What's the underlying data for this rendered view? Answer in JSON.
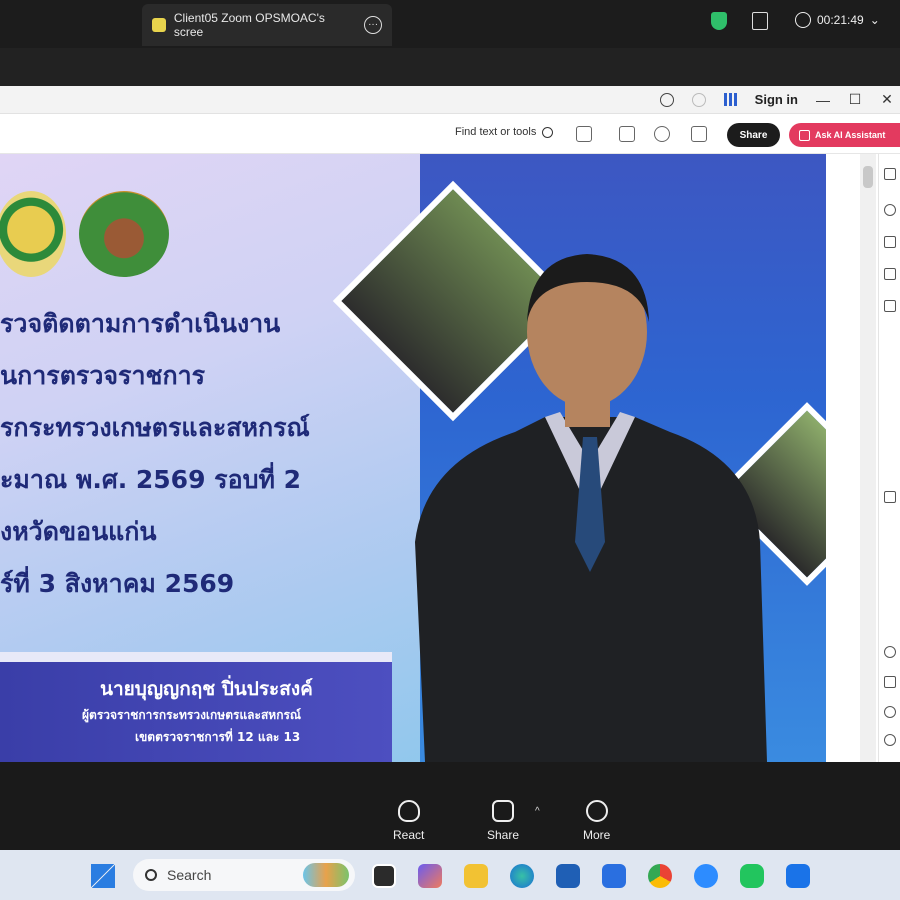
{
  "zoom": {
    "tab_title": "Client05 Zoom OPSMOAC's scree",
    "time": "00:21:49"
  },
  "browser": {
    "sign_in": "Sign in",
    "find_text": "Find text or tools",
    "share": "Share",
    "ask_ai": "Ask AI Assistant"
  },
  "slide": {
    "lines": [
      "รวจติดตามการดำเนินงาน",
      "นการตรวจราชการ",
      "รกระทรวงเกษตรและสหกรณ์",
      "ะมาณ พ.ศ. 2569 รอบที่ 2",
      "งหวัดขอนแก่น",
      "ร์ที่ 3 สิงหาคม 2569"
    ],
    "name": "นายบุญญกฤช  ปิ่นประสงค์",
    "position": "ผู้ตรวจราชการกระทรวงเกษตรและสหกรณ์",
    "region": "เขตตรวจราชการที่ 12 และ 13"
  },
  "controls": {
    "react": "React",
    "share": "Share",
    "more": "More"
  },
  "taskbar": {
    "search_placeholder": "Search"
  },
  "colors": {
    "share_button": "#1c1c1c",
    "ai_button": "#e33a5f",
    "slide_text": "#1f2a78",
    "name_banner": "#3a3ea8"
  },
  "icons": [
    "shield-icon",
    "notes-icon",
    "clock-icon",
    "help-icon",
    "bell-icon",
    "apps-icon",
    "search-icon",
    "heart-icon",
    "share-screen-icon",
    "more-icon",
    "windows-icon"
  ]
}
